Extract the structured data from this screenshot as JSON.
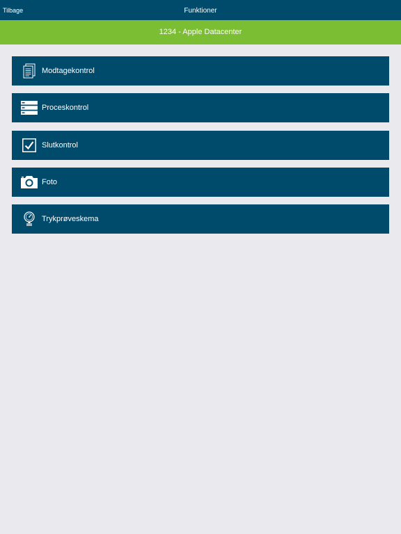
{
  "navbar": {
    "back_label": "Tilbage",
    "title": "Funktioner"
  },
  "subheader": {
    "title": "1234 - Apple Datacenter"
  },
  "menu": {
    "items": [
      {
        "label": "Modtagekontrol",
        "icon": "document-icon"
      },
      {
        "label": "Proceskontrol",
        "icon": "list-icon"
      },
      {
        "label": "Slutkontrol",
        "icon": "checkbox-icon"
      },
      {
        "label": "Foto",
        "icon": "camera-icon"
      },
      {
        "label": "Trykprøveskema",
        "icon": "pressure-gauge-icon"
      }
    ]
  },
  "colors": {
    "navbar_bg": "#004a6b",
    "subheader_bg": "#7bbd33",
    "menu_item_bg": "#004a6b",
    "page_bg": "#eae9ee"
  }
}
